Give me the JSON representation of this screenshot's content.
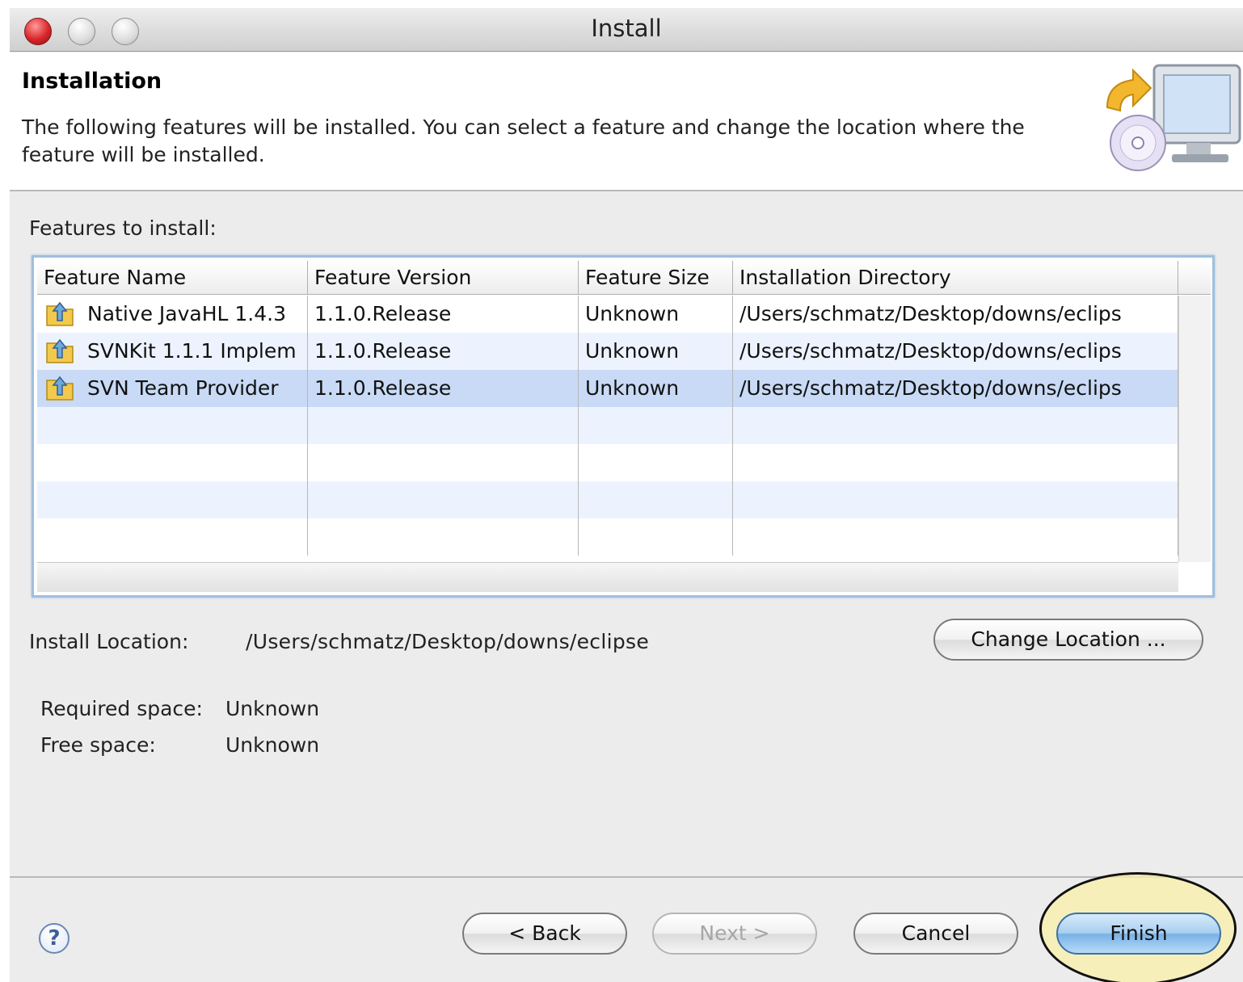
{
  "window": {
    "title": "Install"
  },
  "header": {
    "title": "Installation",
    "description": "The following features will be installed. You can select a feature and change the location where the feature will be installed.",
    "icon": "install-computer-cd-icon"
  },
  "features": {
    "label": "Features to install:",
    "columns": [
      "Feature Name",
      "Feature Version",
      "Feature Size",
      "Installation Directory"
    ],
    "rows": [
      {
        "name": "Native JavaHL 1.4.3",
        "version": "1.1.0.Release",
        "size": "Unknown",
        "directory": "/Users/schmatz/Desktop/downs/eclips"
      },
      {
        "name": "SVNKit 1.1.1 Implem",
        "version": "1.1.0.Release",
        "size": "Unknown",
        "directory": "/Users/schmatz/Desktop/downs/eclips"
      },
      {
        "name": "SVN Team Provider",
        "version": "1.1.0.Release",
        "size": "Unknown",
        "directory": "/Users/schmatz/Desktop/downs/eclips"
      }
    ],
    "selected_row": 2,
    "row_icon": "feature-package-icon"
  },
  "location": {
    "label": "Install Location:",
    "value": "/Users/schmatz/Desktop/downs/eclipse",
    "change_button": "Change Location ..."
  },
  "space": {
    "required_label": "Required space:",
    "required_value": "Unknown",
    "free_label": "Free space:",
    "free_value": "Unknown"
  },
  "buttons": {
    "help": "?",
    "back": "< Back",
    "next": "Next >",
    "cancel": "Cancel",
    "finish": "Finish"
  },
  "colors": {
    "selection": "#c8daf5",
    "alt_row": "#edf3fe",
    "finish_button": "#79b2e6",
    "highlight": "#faf0aa"
  }
}
